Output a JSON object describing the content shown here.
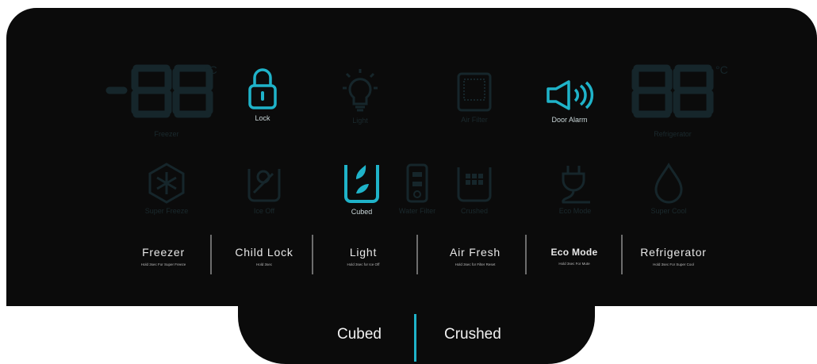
{
  "indicators": {
    "freezer_temp_label": "Freezer",
    "lock_label": "Lock",
    "light_label": "Light",
    "filter_label": "Air Filter",
    "door_alarm_label": "Door  Alarm",
    "fridge_temp_label": "Refrigerator",
    "super_freeze_label": "Super Freeze",
    "ice_off_label": "Ice Off",
    "cubed_label": "Cubed",
    "water_filter_label": "Water Filter",
    "crushed_label": "Crushed",
    "eco_mode_label": "Eco Mode",
    "super_cool_label": "Super Cool",
    "degree_symbol": "°C"
  },
  "buttons": [
    {
      "label": "Freezer",
      "sub": "Hold 3sec For Super Freeze"
    },
    {
      "label": "Child Lock",
      "sub": "Hold 3sec"
    },
    {
      "label": "Light",
      "sub": "Hold 3sec for Ice Off"
    },
    {
      "label": "Air Fresh",
      "sub": "Hold 3sec for Filter Reset"
    },
    {
      "label": "Eco Mode",
      "sub": "Hold  3sec  For  Mute"
    },
    {
      "label": "Refrigerator",
      "sub": "Hold 3sec For Super Cool"
    }
  ],
  "tray": {
    "cubed": "Cubed",
    "crushed": "Crushed"
  },
  "colors": {
    "panel": "#0b0b0b",
    "lit": "#1fb3c9",
    "dim": "#16262b",
    "divider": "#6d6d6d"
  },
  "icons": [
    "lock-icon",
    "bulb-icon",
    "filter-grid-icon",
    "speaker-icon",
    "snowflake-hex-icon",
    "ice-off-icon",
    "cubed-ice-icon",
    "water-filter-icon",
    "crushed-ice-icon",
    "plug-icon",
    "droplet-icon"
  ]
}
